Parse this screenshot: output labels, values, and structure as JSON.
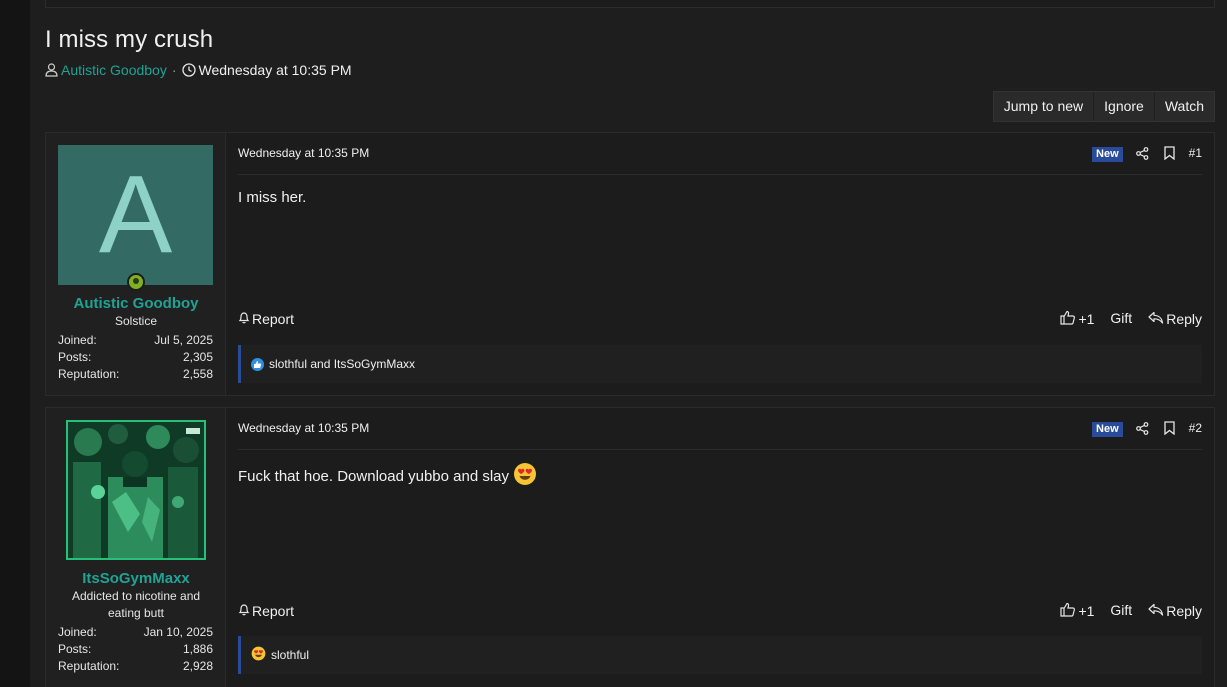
{
  "thread": {
    "title": "I miss my crush",
    "author": "Autistic Goodboy",
    "separator": "·",
    "date": "Wednesday at 10:35 PM"
  },
  "actions": {
    "jump_to_new": "Jump to new",
    "ignore": "Ignore",
    "watch": "Watch"
  },
  "posts": [
    {
      "avatar_letter": "A",
      "username": "Autistic Goodboy",
      "user_title": "Solstice",
      "stats": [
        {
          "label": "Joined:",
          "value": "Jul 5, 2025"
        },
        {
          "label": "Posts:",
          "value": "2,305"
        },
        {
          "label": "Reputation:",
          "value": "2,558"
        }
      ],
      "date": "Wednesday at 10:35 PM",
      "badge": "New",
      "number": "#1",
      "body": "I miss her.",
      "report": "Report",
      "plus_one": "+1",
      "gift": "Gift",
      "reply": "Reply",
      "reactions": "slothful and ItsSoGymMaxx"
    },
    {
      "username": "ItsSoGymMaxx",
      "user_title": "Addicted to nicotine and eating butt",
      "stats": [
        {
          "label": "Joined:",
          "value": "Jan 10, 2025"
        },
        {
          "label": "Posts:",
          "value": "1,886"
        },
        {
          "label": "Reputation:",
          "value": "2,928"
        }
      ],
      "date": "Wednesday at 10:35 PM",
      "badge": "New",
      "number": "#2",
      "body": "Fuck that hoe. Download yubbo and slay",
      "report": "Report",
      "plus_one": "+1",
      "gift": "Gift",
      "reply": "Reply",
      "reactions": "slothful"
    }
  ],
  "colors": {
    "accent": "#1fa394",
    "badge": "#2a4b9a",
    "avatar_bg": "#336b64"
  }
}
